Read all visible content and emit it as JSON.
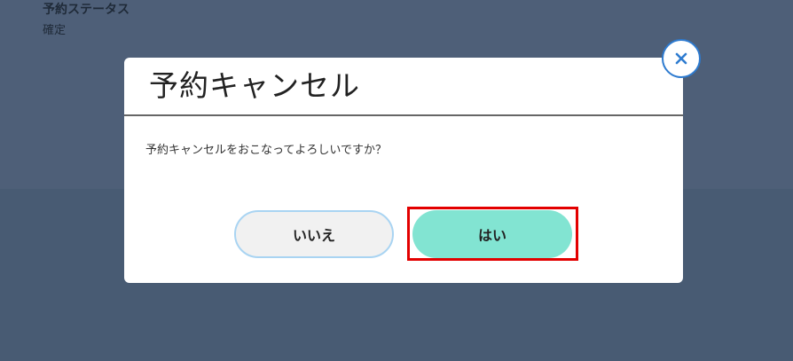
{
  "background": {
    "field_label": "予約ステータス",
    "field_value": "確定"
  },
  "modal": {
    "title": "予約キャンセル",
    "message": "予約キャンセルをおこなってよろしいですか？",
    "no_button": "いいえ",
    "yes_button": "はい",
    "close_icon": "close-icon"
  },
  "colors": {
    "overlay": "#485b73",
    "yes_button": "#82e4d2",
    "no_button_border": "#a9d4f2",
    "close_border": "#2e7bd0",
    "highlight": "#e30000"
  }
}
